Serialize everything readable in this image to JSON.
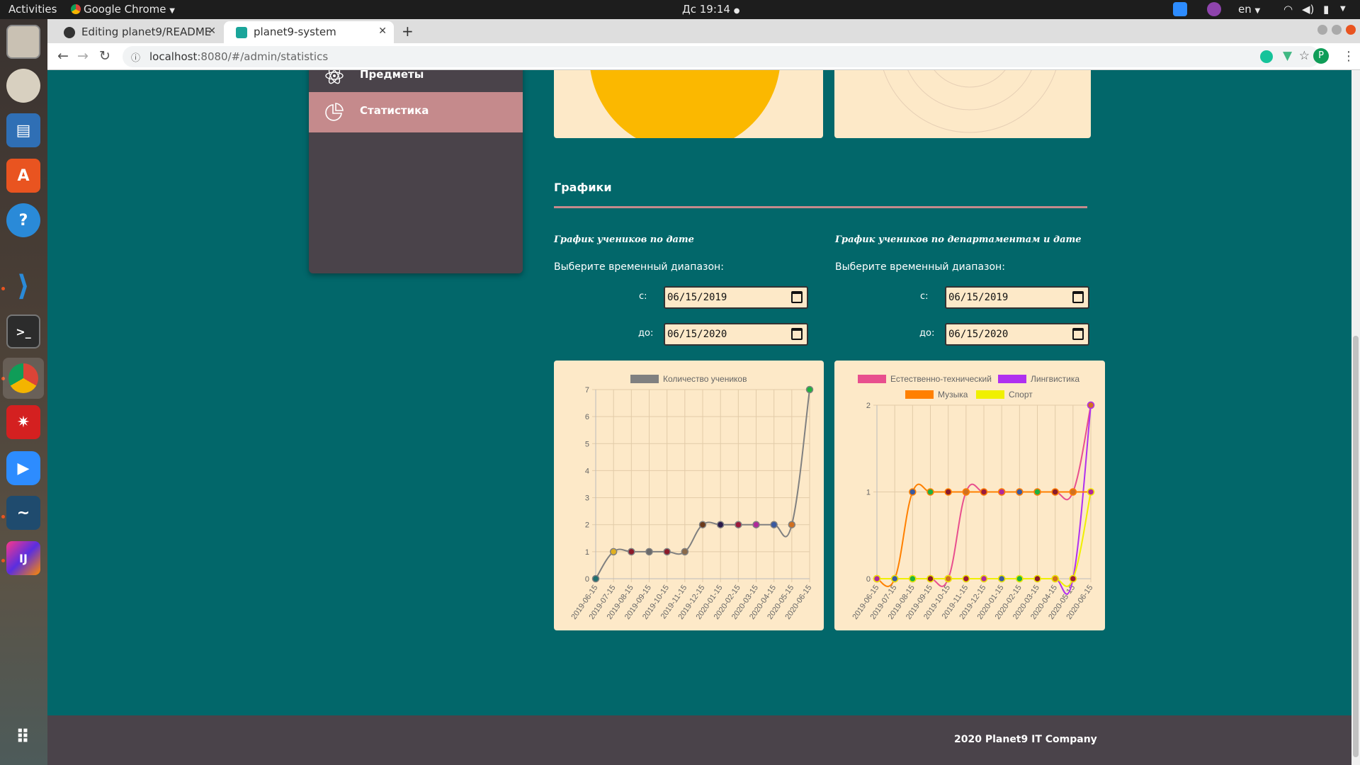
{
  "os": {
    "activities": "Activities",
    "app_menu": "Google Chrome",
    "clock": "Дс 19:14",
    "lang": "en"
  },
  "browser": {
    "tabs": [
      {
        "label": "Editing planet9/README",
        "active": false
      },
      {
        "label": "planet9-system",
        "active": true
      }
    ],
    "url_host": "localhost",
    "url_rest": ":8080/#/admin/statistics",
    "profile_initial": "P"
  },
  "sidebar": {
    "items": [
      {
        "label": "Предметы"
      },
      {
        "label": "Статистика",
        "active": true
      }
    ]
  },
  "main": {
    "section_title": "Графики",
    "range_prompt": "Выберите временный диапазон:",
    "from_label": "с:",
    "to_label": "до:",
    "chart1": {
      "title": "График учеников по дате",
      "from": "06/15/2019",
      "to": "06/15/2020"
    },
    "chart2": {
      "title": "График учеников по департаментам и дате",
      "from": "06/15/2019",
      "to": "06/15/2020"
    }
  },
  "footer": {
    "text": "2020 Planet9 IT Company"
  },
  "colors": {
    "page_bg": "#02676a",
    "card_bg": "#fde9c8",
    "sidebar_bg": "#4a434a",
    "sidebar_active": "#c58a8c"
  },
  "chart_data": [
    {
      "type": "line",
      "x": [
        "2019-06-15",
        "2019-07-15",
        "2019-08-15",
        "2019-09-15",
        "2019-10-15",
        "2019-11-15",
        "2019-12-15",
        "2020-01-15",
        "2020-02-15",
        "2020-03-15",
        "2020-04-15",
        "2020-05-15",
        "2020-06-15"
      ],
      "series": [
        {
          "name": "Количество учеников",
          "color": "#808080",
          "values": [
            0,
            1,
            1,
            1,
            1,
            1,
            2,
            2,
            2,
            2,
            2,
            2,
            7
          ]
        }
      ],
      "point_colors": [
        "#1f6f6f",
        "#e0b020",
        "#8b1a2a",
        "#6a6a6a",
        "#8b1a2a",
        "#8a6a4a",
        "#6b3a1a",
        "#2a1a4a",
        "#9b1a3a",
        "#b02a9a",
        "#3a5aa0",
        "#d07020",
        "#20b040"
      ],
      "ylim": [
        0,
        7
      ],
      "yticks": [
        "0",
        "1",
        "2",
        "3",
        "4",
        "5",
        "6",
        "7"
      ],
      "legend": "top",
      "grid": true
    },
    {
      "type": "line",
      "x": [
        "2019-06-15",
        "2019-07-15",
        "2019-08-15",
        "2019-09-15",
        "2019-10-15",
        "2019-11-15",
        "2019-12-15",
        "2020-01-15",
        "2020-02-15",
        "2020-03-15",
        "2020-04-15",
        "2020-05-15",
        "2020-06-15"
      ],
      "series": [
        {
          "name": "Естественно-технический",
          "color": "#e84f8e",
          "values": [
            0,
            0,
            0,
            0,
            0,
            1,
            1,
            1,
            1,
            1,
            1,
            1,
            2
          ]
        },
        {
          "name": "Лингвистика",
          "color": "#b030f0",
          "values": [
            0,
            0,
            0,
            0,
            0,
            0,
            0,
            0,
            0,
            0,
            0,
            0,
            2
          ]
        },
        {
          "name": "Музыка",
          "color": "#ff8000",
          "values": [
            0,
            0,
            1,
            1,
            1,
            1,
            1,
            1,
            1,
            1,
            1,
            1,
            1
          ]
        },
        {
          "name": "Спорт",
          "color": "#f0f000",
          "values": [
            0,
            0,
            0,
            0,
            0,
            0,
            0,
            0,
            0,
            0,
            0,
            0,
            1
          ]
        }
      ],
      "ylim": [
        0,
        2
      ],
      "yticks": [
        "0",
        "1",
        "2"
      ],
      "legend": "top",
      "grid": true
    }
  ]
}
